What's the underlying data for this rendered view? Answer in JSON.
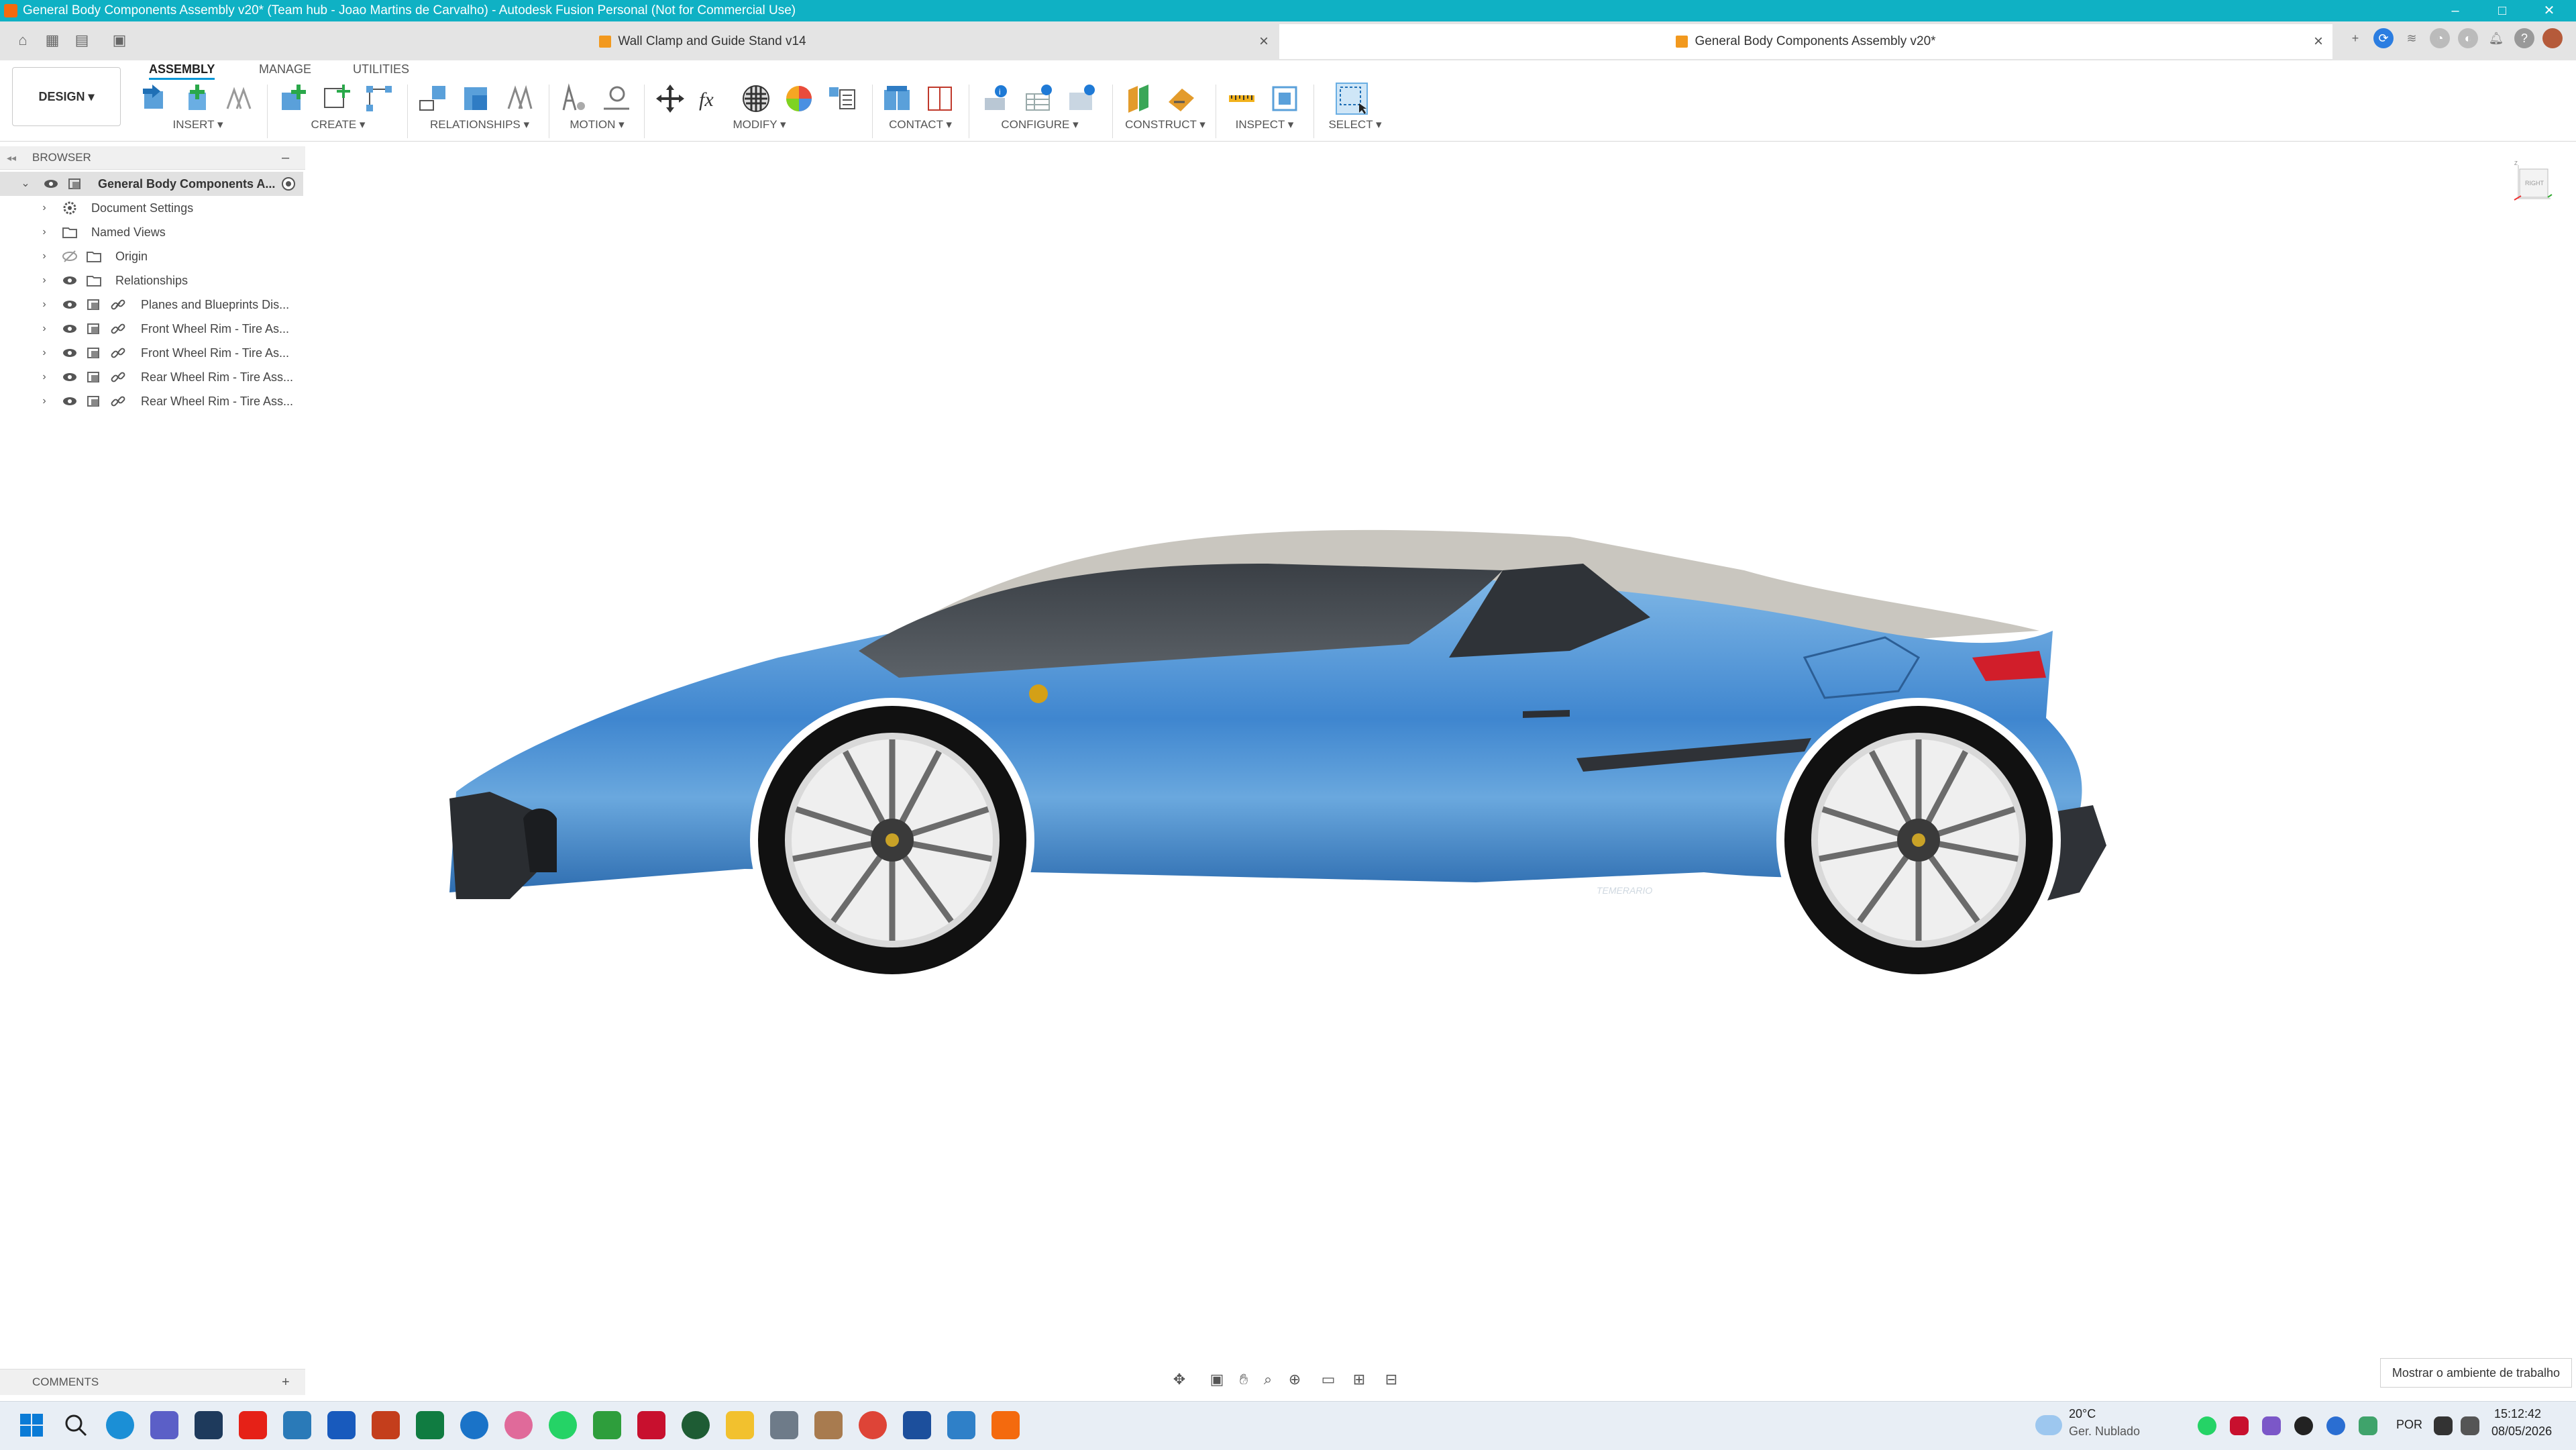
{
  "window": {
    "title": "General Body Components Assembly v20* (Team hub - Joao Martins de Carvalho) - Autodesk Fusion Personal (Not for Commercial Use)",
    "controls": {
      "minimize": "–",
      "maximize": "□",
      "close": "✕"
    }
  },
  "tabs": [
    {
      "label": "Wall Clamp and Guide Stand v14",
      "active": false
    },
    {
      "label": "General Body Components Assembly v20*",
      "active": true
    }
  ],
  "workspace": {
    "label": "DESIGN ▾"
  },
  "ribbon_tabs": [
    "ASSEMBLY",
    "MANAGE",
    "UTILITIES"
  ],
  "groups": {
    "insert": "INSERT ▾",
    "create": "CREATE ▾",
    "relationships": "RELATIONSHIPS ▾",
    "motion": "MOTION ▾",
    "modify": "MODIFY ▾",
    "contact": "CONTACT ▾",
    "configure": "CONFIGURE ▾",
    "construct": "CONSTRUCT ▾",
    "inspect": "INSPECT ▾",
    "select": "SELECT ▾"
  },
  "browser": {
    "title": "BROWSER",
    "collapse": "–",
    "root": "General Body Components A...",
    "items": [
      {
        "label": "Document Settings"
      },
      {
        "label": "Named Views"
      },
      {
        "label": "Origin"
      },
      {
        "label": "Relationships"
      },
      {
        "label": "Planes and Blueprints Dis..."
      },
      {
        "label": "Front Wheel Rim - Tire As..."
      },
      {
        "label": "Front Wheel Rim - Tire As..."
      },
      {
        "label": "Rear Wheel Rim - Tire Ass..."
      },
      {
        "label": "Rear Wheel Rim - Tire Ass..."
      }
    ]
  },
  "comments": {
    "label": "COMMENTS",
    "add": "+"
  },
  "viewcube": {
    "face": "RIGHT",
    "axis_z": "Z"
  },
  "tooltip": "Mostrar o ambiente de trabalho",
  "model": {
    "badge_text": "TEMERARIO"
  },
  "taskbar": {
    "weather_temp": "20°C",
    "weather_desc": "Ger. Nublado",
    "language": "POR",
    "time": "15:12:42",
    "date": "08/05/2026"
  },
  "colors": {
    "titlebar": "#0fb1c4",
    "accent": "#0696d7",
    "car_body": "#4a8fd0",
    "app_orange": "#f46a0e"
  }
}
